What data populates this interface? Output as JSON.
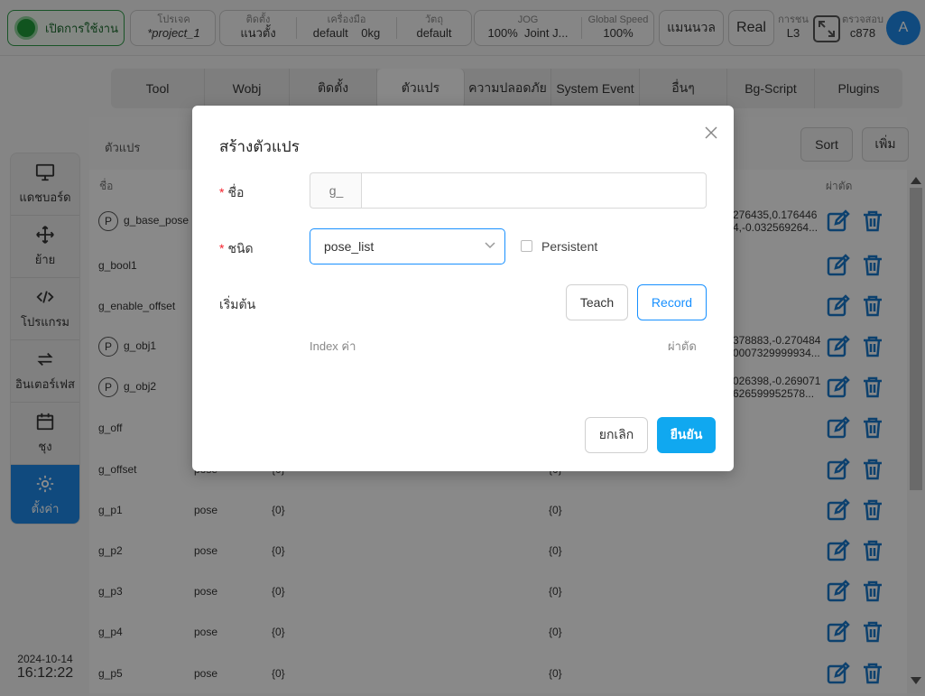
{
  "topbar": {
    "power_label": "เปิดการใช้งาน",
    "project_label": "โปรเจค",
    "project_value": "*project_1",
    "install_label": "ติดตั้ง",
    "install_value": "แนวตั้ง",
    "tool_label": "เครื่องมือ",
    "tool_value": "default",
    "tool_weight": "0kg",
    "object_label": "วัตถุ",
    "object_value": "default",
    "jog_label": "JOG",
    "jog_percent": "100%",
    "jog_mode": "Joint J...",
    "speed_label": "Global Speed",
    "speed_value": "100%",
    "manual_label": "แมนนวล",
    "real_label": "Real",
    "collision_label": "การชน",
    "collision_value": "L3",
    "check_label": "ตรวจสอบ",
    "check_value": "c878",
    "avatar_letter": "A"
  },
  "sidebar": {
    "items": [
      {
        "label": "แดชบอร์ด",
        "icon": "monitor-icon"
      },
      {
        "label": "ย้าย",
        "icon": "move-icon"
      },
      {
        "label": "โปรแกรม",
        "icon": "code-icon"
      },
      {
        "label": "อินเตอร์เฟส",
        "icon": "swap-icon"
      },
      {
        "label": "ชุง",
        "icon": "calendar-icon"
      },
      {
        "label": "ตั้งค่า",
        "icon": "gear-icon"
      }
    ],
    "date": "2024-10-14",
    "time": "16:12:22"
  },
  "tabs": [
    "Tool",
    "Wobj",
    "ติดตั้ง",
    "ตัวแปร",
    "ความปลอดภัย",
    "System Event",
    "อื่นๆ",
    "Bg-Script",
    "Plugins"
  ],
  "content": {
    "section_title": "ตัวแปร",
    "sort_label": "Sort",
    "add_label": "เพิ่ม",
    "col_name": "ชื่อ",
    "col_action": "ผ่าตัด",
    "rows": [
      {
        "name": "g_base_pose",
        "type": "",
        "v1": "",
        "v2": "",
        "extra1": "276435,0.176446",
        "extra2": "4,-0.032569264...",
        "persist": true
      },
      {
        "name": "g_bool1",
        "type": "",
        "v1": "",
        "v2": "",
        "extra1": "",
        "extra2": "",
        "persist": false
      },
      {
        "name": "g_enable_offset",
        "type": "",
        "v1": "",
        "v2": "",
        "extra1": "",
        "extra2": "",
        "persist": false
      },
      {
        "name": "g_obj1",
        "type": "",
        "v1": "",
        "v2": "",
        "extra1": "378883,-0.270484",
        "extra2": "0007329999934...",
        "persist": true
      },
      {
        "name": "g_obj2",
        "type": "",
        "v1": "",
        "v2": "",
        "extra1": "026398,-0.269071",
        "extra2": "626599952578...",
        "persist": true
      },
      {
        "name": "g_off",
        "type": "",
        "v1": "",
        "v2": "",
        "extra1": "",
        "extra2": "",
        "persist": false
      },
      {
        "name": "g_offset",
        "type": "pose",
        "v1": "{0}",
        "v2": "{0}",
        "extra1": "",
        "extra2": "",
        "persist": false
      },
      {
        "name": "g_p1",
        "type": "pose",
        "v1": "{0}",
        "v2": "{0}",
        "extra1": "",
        "extra2": "",
        "persist": false
      },
      {
        "name": "g_p2",
        "type": "pose",
        "v1": "{0}",
        "v2": "{0}",
        "extra1": "",
        "extra2": "",
        "persist": false
      },
      {
        "name": "g_p3",
        "type": "pose",
        "v1": "{0}",
        "v2": "{0}",
        "extra1": "",
        "extra2": "",
        "persist": false
      },
      {
        "name": "g_p4",
        "type": "pose",
        "v1": "{0}",
        "v2": "{0}",
        "extra1": "",
        "extra2": "",
        "persist": false
      },
      {
        "name": "g_p5",
        "type": "pose",
        "v1": "{0}",
        "v2": "{0}",
        "extra1": "",
        "extra2": "",
        "persist": false
      }
    ]
  },
  "modal": {
    "title": "สร้างตัวแปร",
    "name_label": "ชื่อ",
    "name_prefix": "g_",
    "name_value": "",
    "type_label": "ชนิด",
    "type_value": "pose_list",
    "persistent_label": "Persistent",
    "initial_label": "เริ่มต้น",
    "teach_label": "Teach",
    "record_label": "Record",
    "index_header": "Index ค่า",
    "action_header": "ผ่าตัด",
    "cancel_label": "ยกเลิก",
    "confirm_label": "ยืนยัน"
  },
  "colors": {
    "accent": "#1890ff",
    "confirm": "#10a8f0",
    "power_green": "#1f9a3a",
    "sidebar_active": "#1e88e5",
    "row_icon": "#1877c9"
  }
}
